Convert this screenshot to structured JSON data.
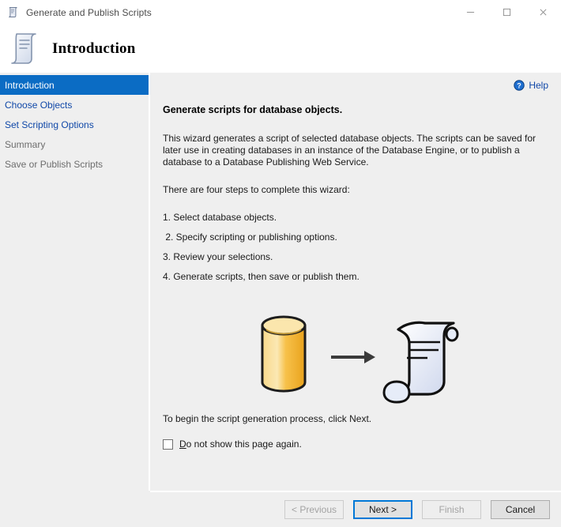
{
  "window": {
    "title": "Generate and Publish Scripts",
    "icon": "script-scroll-icon",
    "controls": {
      "minimize": "minimize-icon",
      "maximize": "maximize-icon",
      "close": "close-icon"
    }
  },
  "header": {
    "title": "Introduction",
    "icon": "script-scroll-icon"
  },
  "sidebar": {
    "items": [
      {
        "label": "Introduction",
        "state": "selected"
      },
      {
        "label": "Choose Objects",
        "state": "link"
      },
      {
        "label": "Set Scripting Options",
        "state": "link"
      },
      {
        "label": "Summary",
        "state": "disabled"
      },
      {
        "label": "Save or Publish Scripts",
        "state": "disabled"
      }
    ]
  },
  "help": {
    "label": "Help",
    "icon": "help-circle-icon"
  },
  "main": {
    "section_title": "Generate scripts for database objects.",
    "description": "This wizard generates a script of selected database objects. The scripts can be saved for later use in creating databases in an instance of the Database Engine, or to publish a database to a Database Publishing Web Service.",
    "steps_intro": "There are four steps to complete this wizard:",
    "steps": [
      "1. Select database objects.",
      " 2. Specify scripting or publishing options.",
      "3. Review your selections.",
      "4. Generate scripts, then save or publish them."
    ],
    "illustration": {
      "source_icon": "database-cylinder-icon",
      "arrow_icon": "arrow-right-icon",
      "target_icon": "script-scroll-icon"
    },
    "begin_text": "To begin the script generation process, click Next.",
    "checkbox": {
      "accelerator": "D",
      "label_rest": "o not show this page again.",
      "checked": false
    }
  },
  "footer": {
    "buttons": [
      {
        "label": "< Previous",
        "accelerator": "P",
        "state": "disabled"
      },
      {
        "label": "Next >",
        "accelerator": "N",
        "state": "focused"
      },
      {
        "label": "Finish",
        "accelerator": "F",
        "state": "disabled"
      },
      {
        "label": "Cancel",
        "accelerator": "",
        "state": "enabled"
      }
    ]
  },
  "colors": {
    "selection_blue": "#0b6cc4",
    "link_blue": "#1048a8",
    "focus_blue": "#0078d7",
    "panel_gray": "#efefef",
    "database_yellow": "#f5b931"
  }
}
